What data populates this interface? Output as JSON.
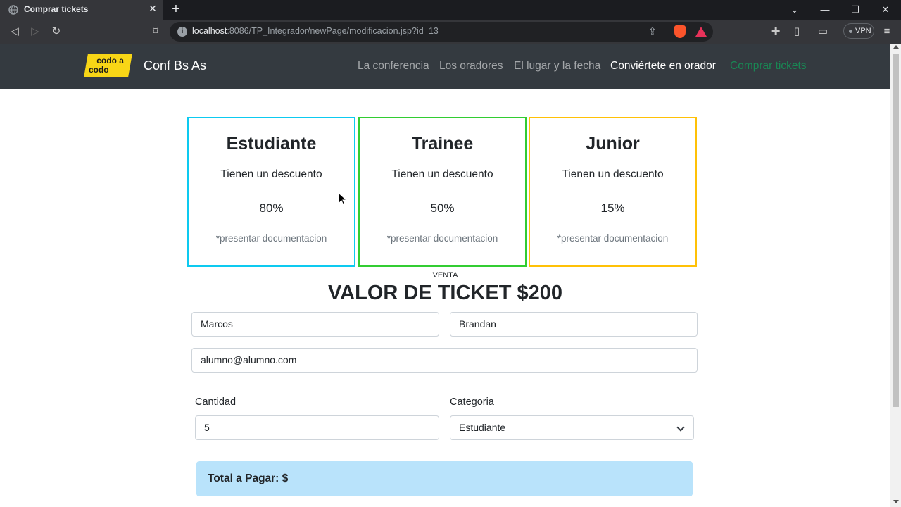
{
  "browser": {
    "tab_title": "Comprar tickets",
    "url_host": "localhost",
    "url_rest": ":8086/TP_Integrador/newPage/modificacion.jsp?id=13",
    "vpn_label": "VPN"
  },
  "navbar": {
    "logo_top": "codo a",
    "logo_bottom": "codo",
    "brand": "Conf Bs As",
    "links": [
      {
        "label": "La conferencia"
      },
      {
        "label": "Los oradores"
      },
      {
        "label": "El lugar y la fecha"
      },
      {
        "label": "Conviértete en orador"
      },
      {
        "label": "Comprar tickets"
      }
    ]
  },
  "cards": [
    {
      "title": "Estudiante",
      "desc": "Tienen un descuento",
      "pct": "80%",
      "note": "*presentar documentacion",
      "border": "#0dcaf0"
    },
    {
      "title": "Trainee",
      "desc": "Tienen un descuento",
      "pct": "50%",
      "note": "*presentar documentacion",
      "border": "#32cd32"
    },
    {
      "title": "Junior",
      "desc": "Tienen un descuento",
      "pct": "15%",
      "note": "*presentar documentacion",
      "border": "#ffc107"
    }
  ],
  "sale": {
    "eyebrow": "VENTA",
    "headline": "VALOR DE TICKET $200"
  },
  "form": {
    "nombre": "Marcos",
    "apellido": "Brandan",
    "email": "alumno@alumno.com",
    "cantidad_label": "Cantidad",
    "cantidad": "5",
    "categoria_label": "Categoria",
    "categoria": "Estudiante",
    "total_label": "Total a Pagar: $"
  },
  "colors": {
    "navbar_bg": "#343a40",
    "total_bg": "#b9e3fb",
    "logo_yellow": "#f8d616"
  }
}
